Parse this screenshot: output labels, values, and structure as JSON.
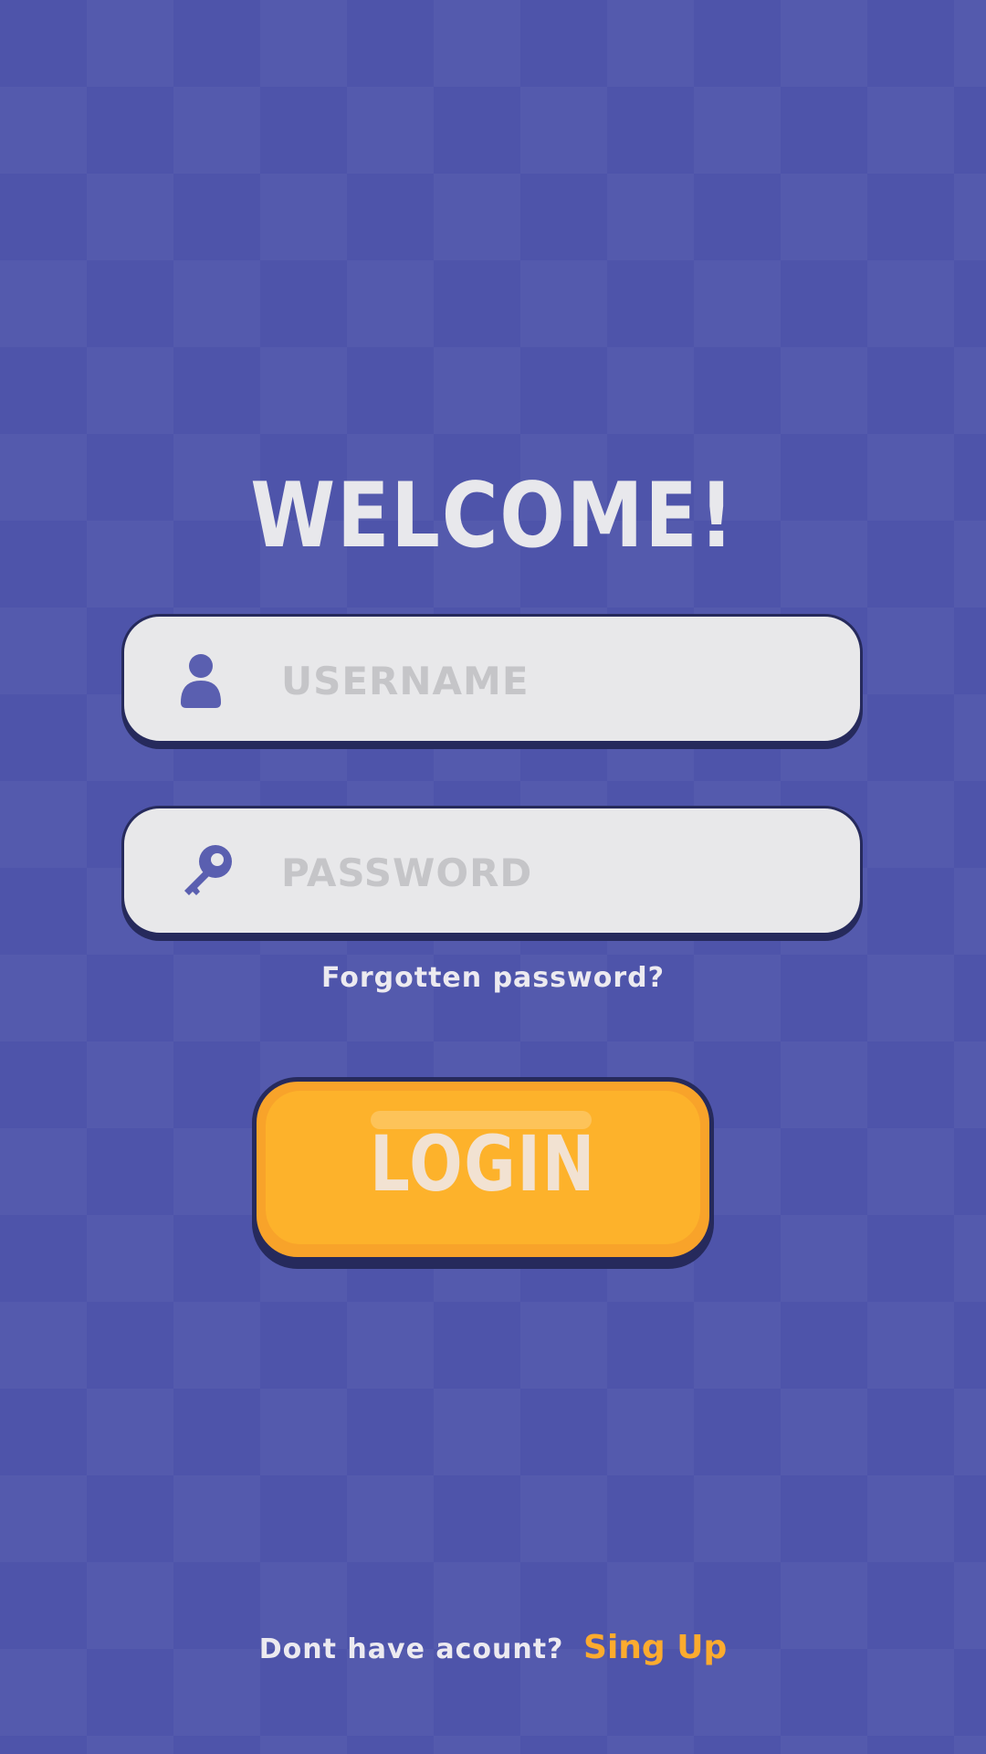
{
  "welcome": {
    "title": "WELCOME!"
  },
  "username": {
    "placeholder": "USERNAME",
    "value": "",
    "icon": "user-icon"
  },
  "password": {
    "placeholder": "PASSWORD",
    "value": "",
    "icon": "key-icon"
  },
  "forgot": {
    "label": "Forgotten password?"
  },
  "login": {
    "label": "LOGIN"
  },
  "signup": {
    "prompt": "Dont have acount?",
    "link": "Sing Up"
  },
  "colors": {
    "background": "#4e54aa",
    "field_bg": "#e8e8ea",
    "outline": "#262a5c",
    "accent": "#fdb22b",
    "icon": "#5a5fb0",
    "text_light": "#eceaf0"
  }
}
